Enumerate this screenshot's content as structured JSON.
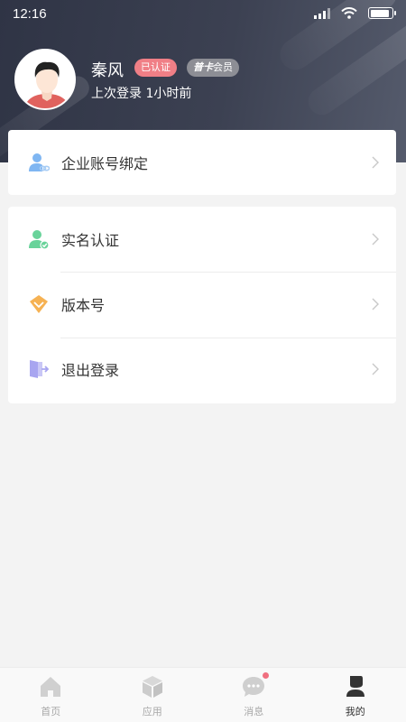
{
  "status_bar": {
    "time": "12:16",
    "battery_level": 0.9
  },
  "profile": {
    "name": "秦风",
    "badge_verified": "已认证",
    "badge_member_prefix": "普卡",
    "badge_member_suffix": "会员",
    "last_login": "上次登录 1小时前"
  },
  "menu": {
    "group1": [
      {
        "label": "企业账号绑定",
        "icon": "user-link-icon"
      }
    ],
    "group2": [
      {
        "label": "实名认证",
        "icon": "user-check-icon"
      },
      {
        "label": "版本号",
        "icon": "diamond-icon"
      },
      {
        "label": "退出登录",
        "icon": "logout-icon"
      }
    ]
  },
  "tabbar": {
    "tabs": [
      {
        "label": "首页",
        "icon": "home-icon",
        "active": false
      },
      {
        "label": "应用",
        "icon": "cube-icon",
        "active": false
      },
      {
        "label": "消息",
        "icon": "message-icon",
        "active": false,
        "has_dot": true
      },
      {
        "label": "我的",
        "icon": "profile-icon",
        "active": true
      }
    ]
  },
  "colors": {
    "header": "#3c4152",
    "badge_verified": "#f07f86",
    "badge_member": "#8d8e95",
    "icon_blue": "#7fb6f2",
    "icon_green": "#69d39a",
    "icon_orange": "#f6b253",
    "icon_purple": "#a8a5f0"
  }
}
